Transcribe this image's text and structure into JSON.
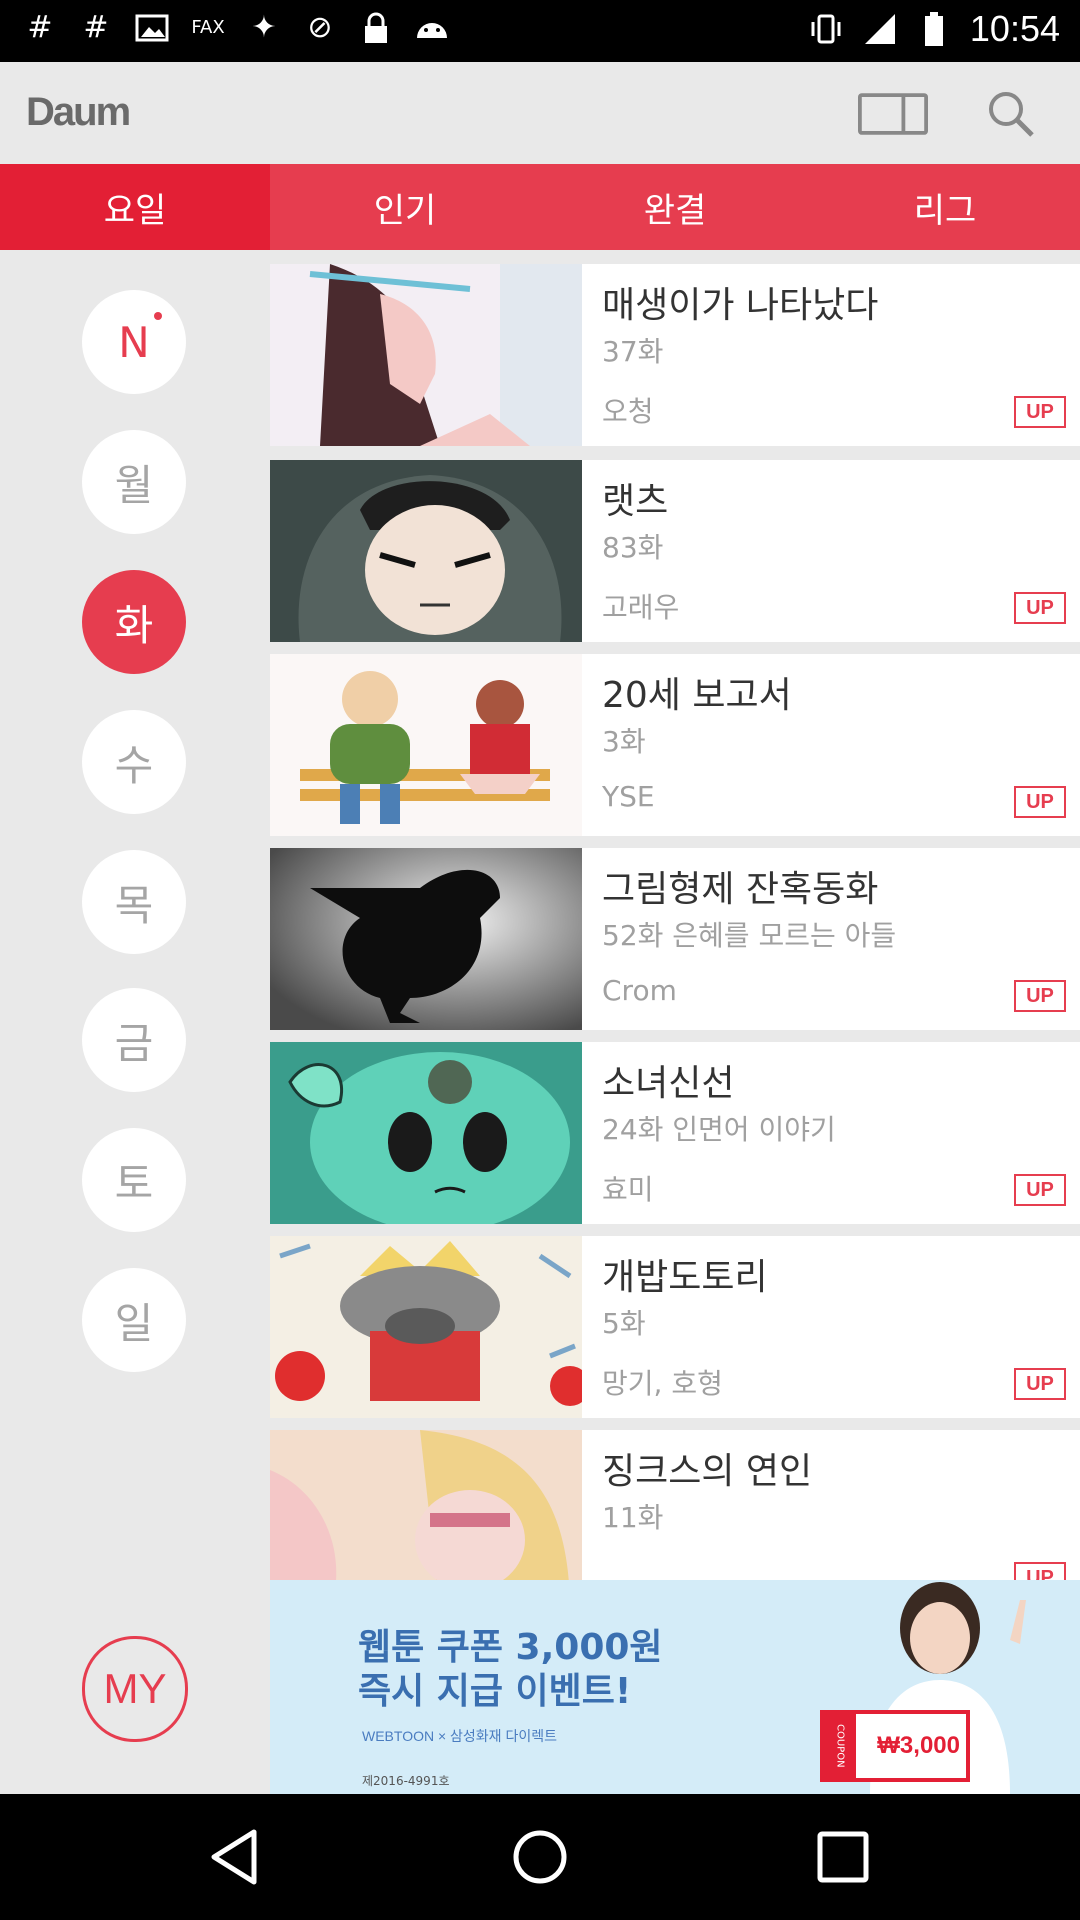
{
  "status_bar": {
    "time": "10:54",
    "icons": [
      "hash-icon",
      "hash-icon",
      "image-icon",
      "fax-icon",
      "satellite-icon",
      "dnd-icon",
      "lock-icon",
      "android-icon",
      "vibrate-icon",
      "signal-icon",
      "battery-icon"
    ]
  },
  "header": {
    "logo": "Daum",
    "icons": [
      "book-icon",
      "search-icon"
    ]
  },
  "tabs": [
    {
      "label": "요일",
      "active": true
    },
    {
      "label": "인기",
      "active": false
    },
    {
      "label": "완결",
      "active": false
    },
    {
      "label": "리그",
      "active": false
    }
  ],
  "sidebar": {
    "days": [
      {
        "label": "N",
        "active": false,
        "new_dot": true
      },
      {
        "label": "월",
        "active": false
      },
      {
        "label": "화",
        "active": true
      },
      {
        "label": "수",
        "active": false
      },
      {
        "label": "목",
        "active": false
      },
      {
        "label": "금",
        "active": false
      },
      {
        "label": "토",
        "active": false
      },
      {
        "label": "일",
        "active": false
      }
    ],
    "my_label": "MY"
  },
  "list": [
    {
      "title": "매생이가 나타났다",
      "episode": "37화",
      "author": "오청",
      "badge": "UP"
    },
    {
      "title": "랫츠",
      "episode": "83화",
      "author": "고래우",
      "badge": "UP"
    },
    {
      "title": "20세 보고서",
      "episode": "3화",
      "author": "YSE",
      "badge": "UP"
    },
    {
      "title": "그림형제 잔혹동화",
      "episode": "52화 은혜를 모르는 아들",
      "author": "Crom",
      "badge": "UP"
    },
    {
      "title": "소녀신선",
      "episode": "24화 인면어 이야기",
      "author": "효미",
      "badge": "UP"
    },
    {
      "title": "개밥도토리",
      "episode": "5화",
      "author": "망기, 호형",
      "badge": "UP"
    },
    {
      "title": "징크스의 연인",
      "episode": "11화",
      "author": "",
      "badge": "UP"
    }
  ],
  "ad": {
    "line1": "웹툰 쿠폰 3,000원",
    "line2": "즉시 지급 이벤트!",
    "brand": "WEBTOON × 삼성화재 다이렉트",
    "coupon_tag": "COUPON",
    "coupon_amount": "₩3,000",
    "reg": "제2016-4991호"
  },
  "navbar": {
    "buttons": [
      "back-icon",
      "home-icon",
      "recents-icon"
    ]
  },
  "colors": {
    "accent": "#e63d4f",
    "tab_active": "#e31f35",
    "header_bg": "#e9e9e9"
  }
}
